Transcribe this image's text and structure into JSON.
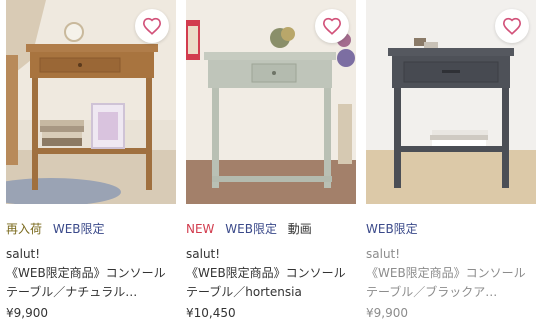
{
  "products": [
    {
      "badges": [
        {
          "text": "再入荷",
          "kind": "restock"
        },
        {
          "text": "WEB限定",
          "kind": "web"
        }
      ],
      "brand": "salut!",
      "name": "《WEB限定商品》コンソールテーブル／ナチュラル…",
      "price": "¥9,900",
      "favorite_icon": "heart-outline-icon",
      "image": "wooden-console-table-natural"
    },
    {
      "badges": [
        {
          "text": "NEW",
          "kind": "new"
        },
        {
          "text": "WEB限定",
          "kind": "web"
        },
        {
          "text": "動画",
          "kind": "video"
        }
      ],
      "brand": "salut!",
      "name": "《WEB限定商品》コンソールテーブル／hortensia",
      "price": "¥10,450",
      "favorite_icon": "heart-outline-icon",
      "image": "sage-console-table-hortensia"
    },
    {
      "badges": [
        {
          "text": "WEB限定",
          "kind": "web"
        }
      ],
      "brand": "salut!",
      "name": "《WEB限定商品》コンソールテーブル／ブラックア…",
      "price": "¥9,900",
      "favorite_icon": "heart-outline-icon",
      "image": "dark-gray-console-table"
    }
  ],
  "colors": {
    "heart": "#d2527a",
    "badge_new": "#d23c4e",
    "badge_web": "#3b4a8a",
    "badge_restock": "#7a6a1e"
  }
}
